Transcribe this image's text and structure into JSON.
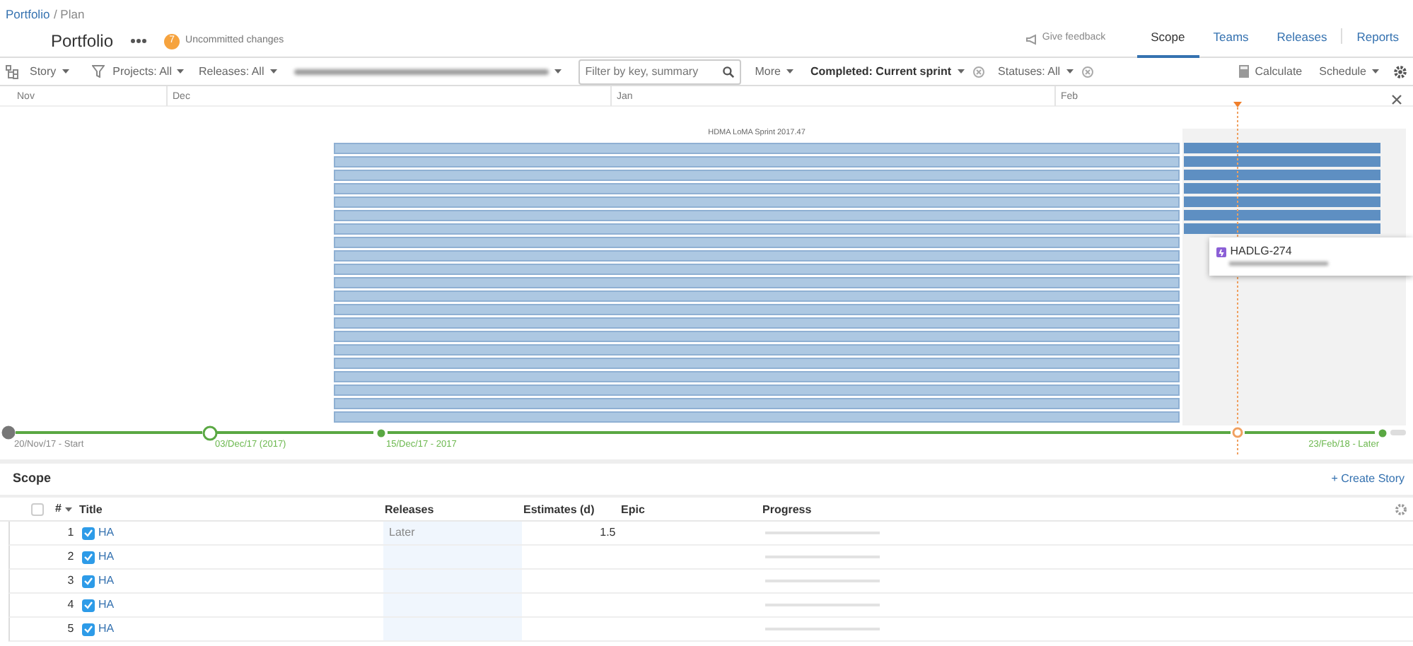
{
  "breadcrumb": [
    {
      "label": "Portfolio",
      "kind": "link"
    },
    {
      "label": "/ Plan",
      "kind": "text"
    }
  ],
  "title": "Portfolio",
  "changes": {
    "count": "7",
    "label": "Uncommitted changes"
  },
  "feedback": "Give feedback",
  "tabs": [
    {
      "label": "Scope",
      "selected": true
    },
    {
      "label": "Teams",
      "selected": false
    },
    {
      "label": "Releases",
      "selected": false
    },
    {
      "label": "Reports",
      "selected": false
    }
  ],
  "toolbar": {
    "hierarchy": "Story",
    "projects": "Projects: All",
    "releases": "Releases: All",
    "search": {
      "placeholder": "Filter by key, summary"
    },
    "more": "More",
    "completed": "Completed: Current sprint",
    "statuses": "Statuses: All",
    "calculate": "Calculate",
    "schedule": "Schedule"
  },
  "timeline": {
    "months": [
      "Nov",
      "Dec",
      "Jan",
      "Feb"
    ],
    "sprint": "HDMA LoMA Sprint 2017.47",
    "milestones": [
      {
        "label": "20/Nov/17 - Start",
        "kind": "start"
      },
      {
        "label": "03/Dec/17 (2017)",
        "kind": "sprint"
      },
      {
        "label": "15/Dec/17 - 2017",
        "kind": "release"
      },
      {
        "kind": "today"
      },
      {
        "label": "23/Feb/18 - Later",
        "kind": "end"
      }
    ],
    "popup": {
      "key": "HADLG-274"
    }
  },
  "scope": {
    "title": "Scope",
    "create": "+ Create Story",
    "all_selected": false,
    "columns": [
      "#",
      "Title",
      "Releases",
      "Estimates (d)",
      "Epic",
      "Progress"
    ],
    "rows": [
      {
        "num": "1",
        "checked": true,
        "title": "HA",
        "release": "Later",
        "estimate": "1.5",
        "level": 0
      },
      {
        "num": "2",
        "checked": true,
        "title": "HA",
        "level": 0
      },
      {
        "num": "3",
        "checked": true,
        "title": "HA",
        "level": 0
      },
      {
        "num": "4",
        "checked": true,
        "title": "HA",
        "level": 0
      },
      {
        "num": "5",
        "checked": true,
        "title": "HA",
        "level": 0
      }
    ]
  }
}
